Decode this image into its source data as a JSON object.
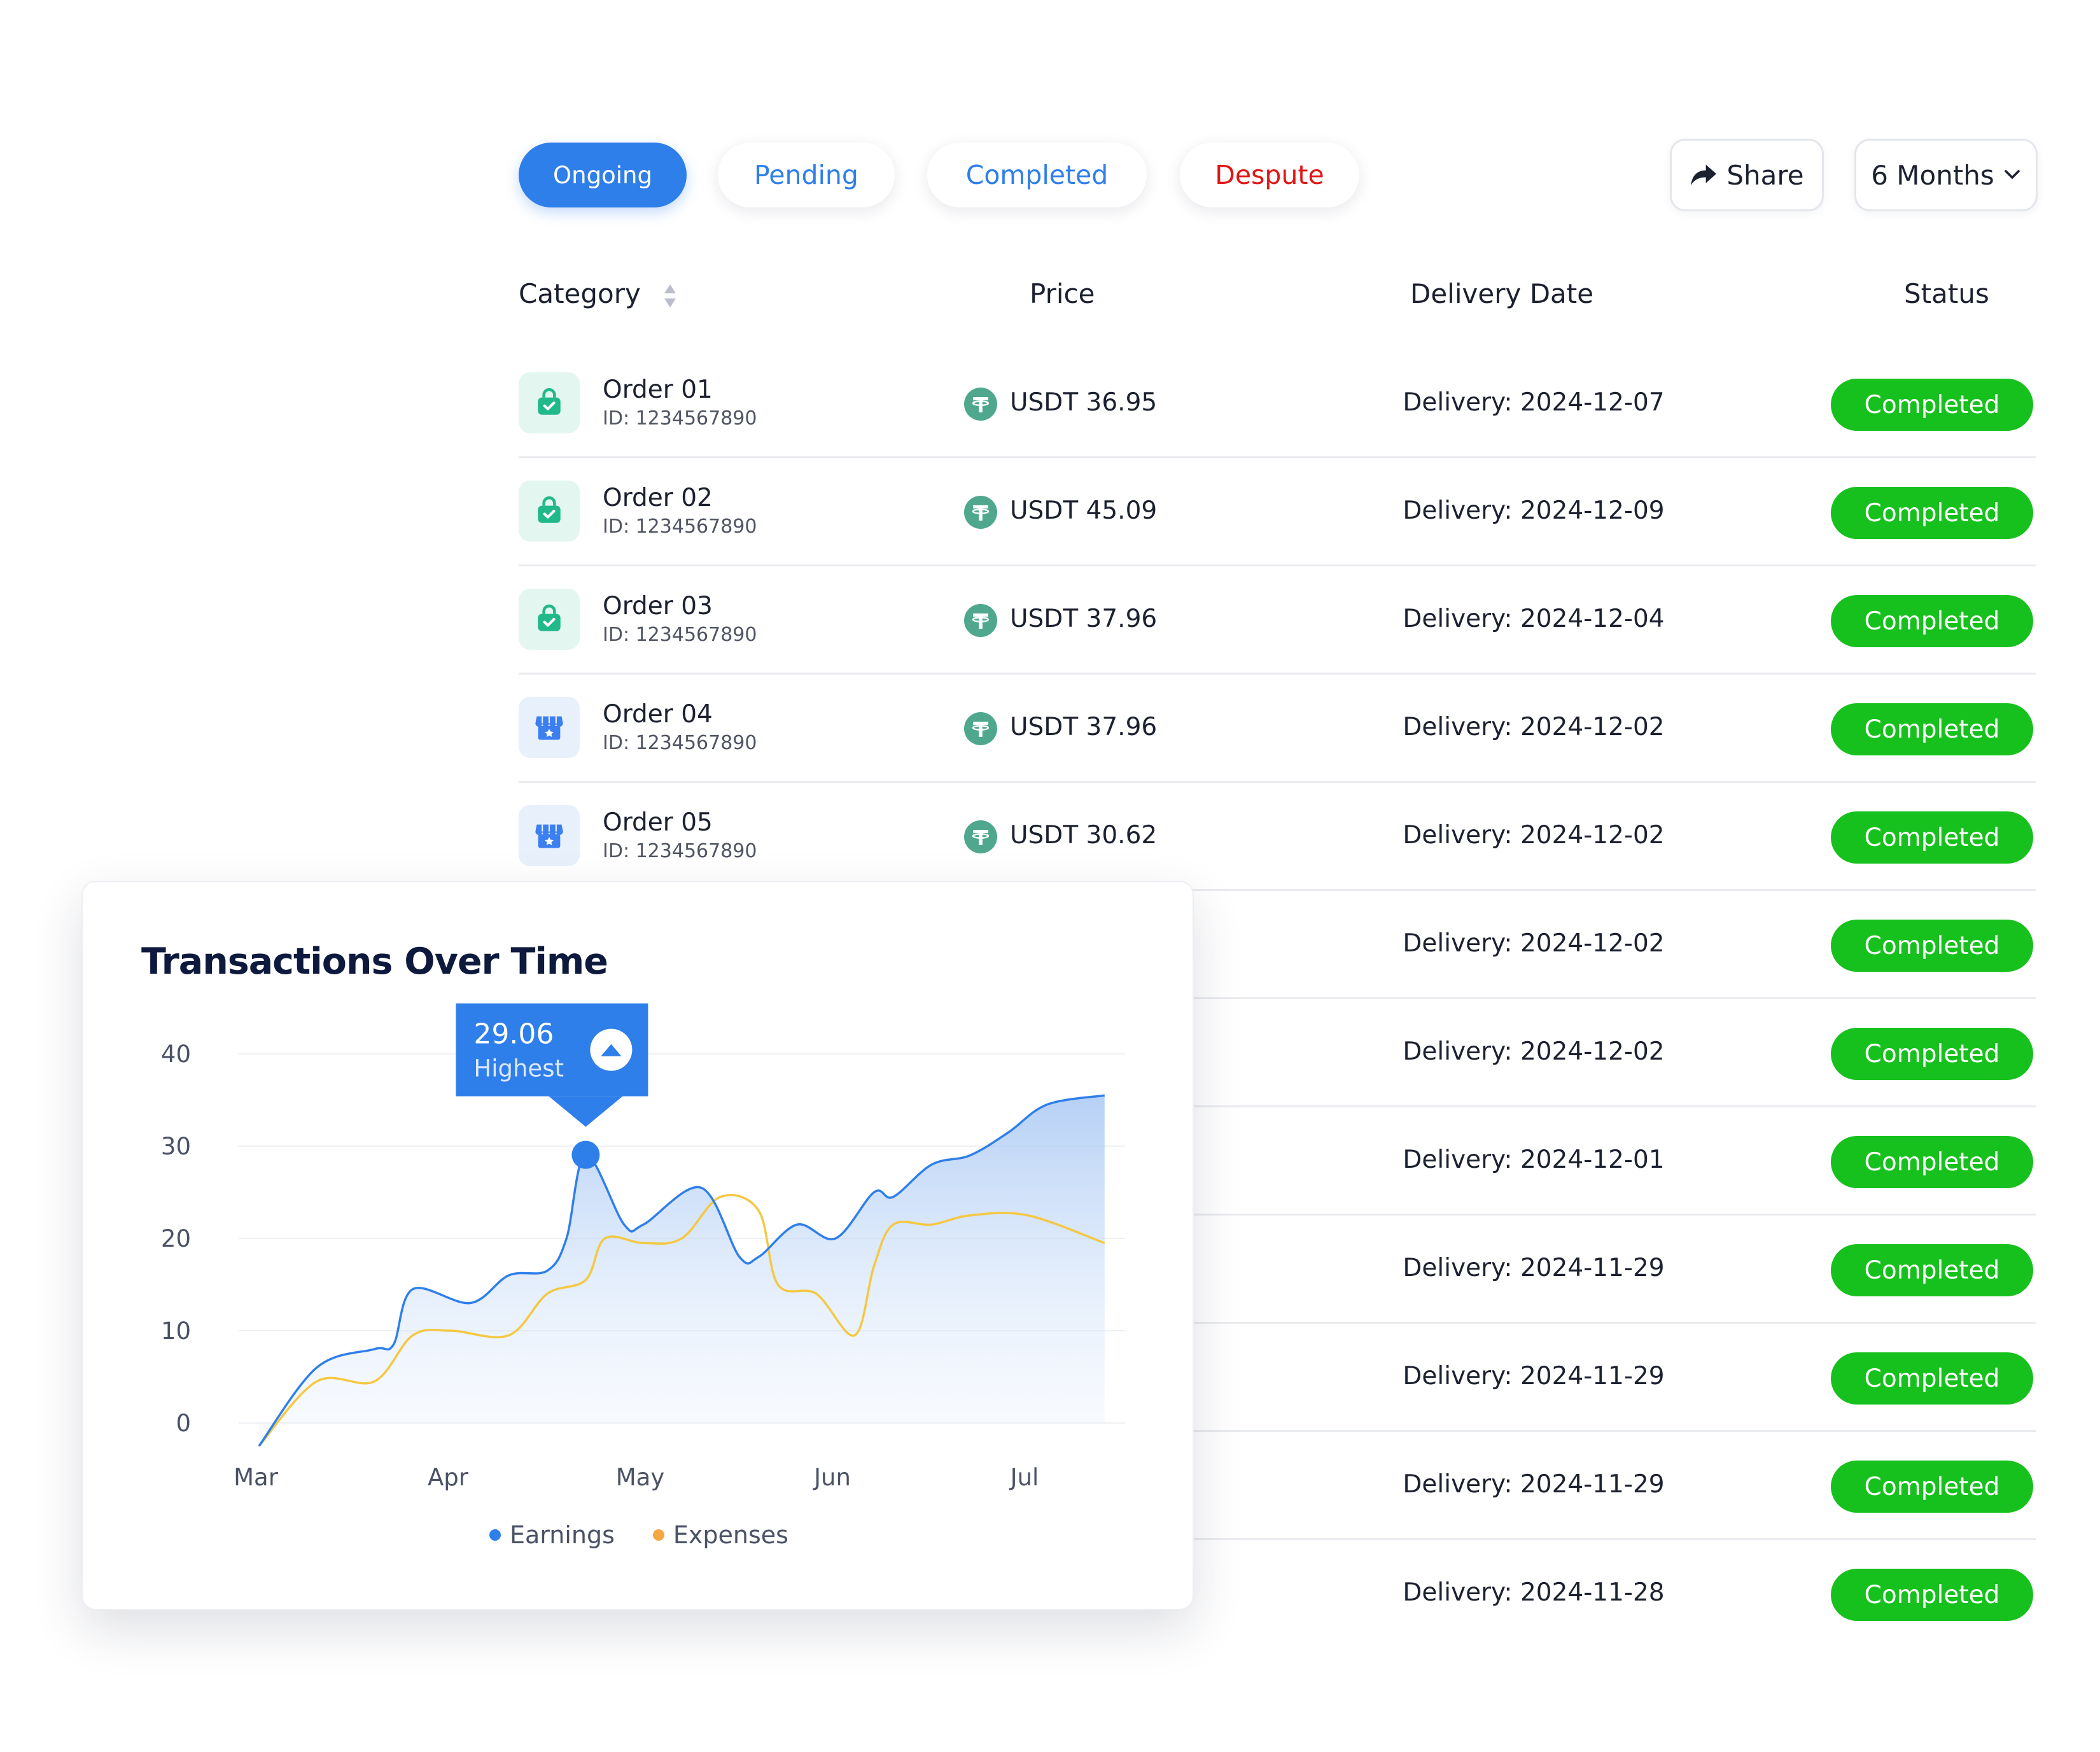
{
  "tabs": [
    {
      "label": "Ongoing",
      "state": "active"
    },
    {
      "label": "Pending",
      "state": "blue"
    },
    {
      "label": "Completed",
      "state": "blue"
    },
    {
      "label": "Despute",
      "state": "red"
    }
  ],
  "toolbar": {
    "share_label": "Share",
    "period_label": "6 Months"
  },
  "table": {
    "headers": {
      "category": "Category",
      "price": "Price",
      "delivery": "Delivery Date",
      "status": "Status"
    },
    "rows": [
      {
        "name": "Order 01",
        "id": "ID: 1234567890",
        "icon": "shopping-bag-icon",
        "price": "USDT 36.95",
        "delivery": "Delivery: 2024-12-07",
        "status": "Completed"
      },
      {
        "name": "Order 02",
        "id": "ID: 1234567890",
        "icon": "shopping-bag-icon",
        "price": "USDT 45.09",
        "delivery": "Delivery: 2024-12-09",
        "status": "Completed"
      },
      {
        "name": "Order 03",
        "id": "ID: 1234567890",
        "icon": "shopping-bag-icon",
        "price": "USDT 37.96",
        "delivery": "Delivery: 2024-12-04",
        "status": "Completed"
      },
      {
        "name": "Order 04",
        "id": "ID: 1234567890",
        "icon": "store-icon",
        "price": "USDT 37.96",
        "delivery": "Delivery: 2024-12-02",
        "status": "Completed"
      },
      {
        "name": "Order 05",
        "id": "ID: 1234567890",
        "icon": "store-icon",
        "price": "USDT 30.62",
        "delivery": "Delivery: 2024-12-02",
        "status": "Completed"
      },
      {
        "delivery": "Delivery: 2024-12-02",
        "status": "Completed"
      },
      {
        "delivery": "Delivery: 2024-12-02",
        "status": "Completed"
      },
      {
        "delivery": "Delivery: 2024-12-01",
        "status": "Completed"
      },
      {
        "delivery": "Delivery: 2024-11-29",
        "status": "Completed"
      },
      {
        "delivery": "Delivery: 2024-11-29",
        "status": "Completed"
      },
      {
        "delivery": "Delivery: 2024-11-29",
        "status": "Completed"
      },
      {
        "delivery": "Delivery: 2024-11-28",
        "status": "Completed"
      }
    ]
  },
  "colors": {
    "accent": "#2f7fea",
    "status_green": "#17c11d",
    "dispute_red": "#e21616",
    "expenses": "#f5c842",
    "icon_green": "#22b98a"
  },
  "chart_data": {
    "type": "area",
    "title": "Transactions Over Time",
    "x_ticks": [
      "Mar",
      "Apr",
      "May",
      "Jun",
      "Jul"
    ],
    "y_ticks": [
      "0",
      "10",
      "20",
      "30",
      "40"
    ],
    "ylim": [
      0,
      40
    ],
    "grid": true,
    "legend_position": "bottom",
    "series": [
      {
        "name": "Earnings",
        "color": "#2f7fea",
        "x": [
          0,
          0.3,
          0.6,
          0.7,
          0.8,
          1.1,
          1.3,
          1.5,
          1.6,
          1.7,
          1.9,
          2.0,
          2.3,
          2.5,
          2.6,
          2.8,
          3.0,
          3.2,
          3.3,
          3.5,
          3.7,
          3.9,
          4.1,
          4.4
        ],
        "values": [
          -2.5,
          6,
          8,
          8.5,
          14.5,
          13,
          16,
          16.5,
          20,
          29.06,
          21.5,
          21.5,
          25.5,
          18,
          18,
          21.5,
          20,
          25,
          24.5,
          28,
          29,
          31.5,
          34.5,
          35.5
        ]
      },
      {
        "name": "Expenses",
        "color": "#f5c842",
        "x": [
          0,
          0.3,
          0.6,
          0.8,
          1.0,
          1.3,
          1.5,
          1.7,
          1.8,
          2.0,
          2.2,
          2.4,
          2.6,
          2.7,
          2.9,
          3.1,
          3.2,
          3.3,
          3.5,
          3.7,
          4.0,
          4.4
        ],
        "values": [
          -2.5,
          4.5,
          4.5,
          9.5,
          10,
          9.5,
          14,
          15.5,
          20,
          19.5,
          20,
          24.5,
          23,
          15,
          14,
          9.5,
          17,
          21.5,
          21.5,
          22.5,
          22.5,
          19.5
        ]
      }
    ],
    "annotation": {
      "value": "29.06",
      "label": "Highest",
      "x": 1.7,
      "y": 29.06
    }
  }
}
